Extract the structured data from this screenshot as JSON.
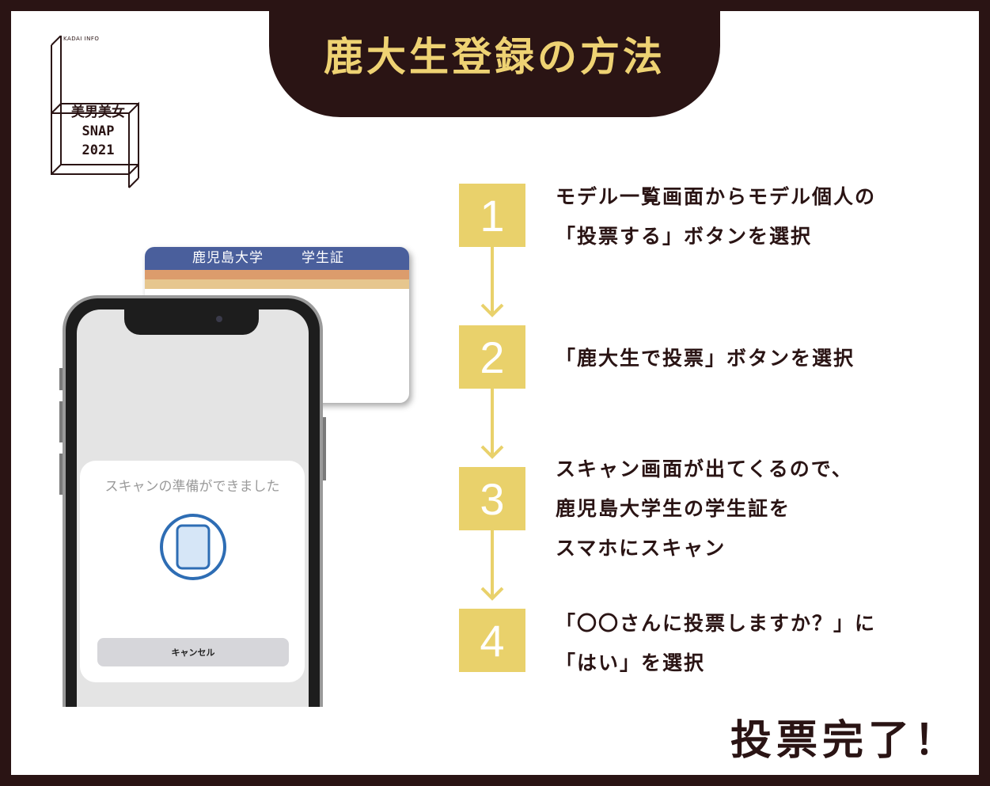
{
  "title": "鹿大生登録の方法",
  "logo": {
    "subtext": "KADAI INFO",
    "lines": [
      "美男美女",
      "SNAP",
      "2021"
    ]
  },
  "card": {
    "university": "鹿児島大学",
    "label": "学生証"
  },
  "phone": {
    "sheet_title": "スキャンの準備ができました",
    "cancel_label": "キャンセル"
  },
  "steps": [
    {
      "number": "1",
      "lines": [
        "モデル一覧画面からモデル個人の",
        "「投票する」ボタンを選択"
      ]
    },
    {
      "number": "2",
      "lines": [
        "「鹿大生で投票」ボタンを選択"
      ]
    },
    {
      "number": "3",
      "lines": [
        "スキャン画面が出てくるので、",
        "鹿児島大学生の学生証を",
        "スマホにスキャン"
      ]
    },
    {
      "number": "4",
      "lines": [
        "「〇〇さんに投票しますか？」に",
        "「はい」を選択"
      ]
    }
  ],
  "completion": "投票完了！",
  "colors": {
    "dark": "#2a1414",
    "accent": "#eed273",
    "step": "#e9d16b",
    "card_header": "#4a5f9c",
    "scan_icon": "#2e6db4"
  }
}
